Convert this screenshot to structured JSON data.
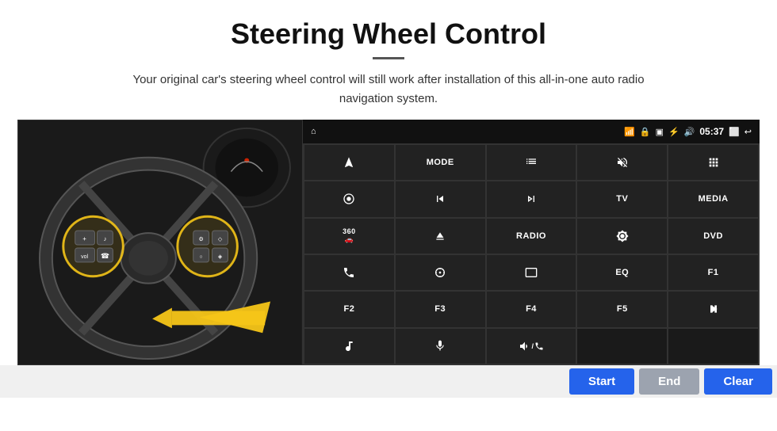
{
  "header": {
    "title": "Steering Wheel Control",
    "subtitle": "Your original car's steering wheel control will still work after installation of this all-in-one auto radio navigation system."
  },
  "statusBar": {
    "time": "05:37",
    "icons": [
      "home",
      "wifi",
      "lock",
      "sim",
      "bluetooth",
      "volume",
      "back"
    ]
  },
  "buttons": [
    {
      "id": "b1",
      "type": "icon",
      "icon": "navigate",
      "label": ""
    },
    {
      "id": "b2",
      "type": "text",
      "label": "MODE"
    },
    {
      "id": "b3",
      "type": "icon",
      "icon": "list",
      "label": ""
    },
    {
      "id": "b4",
      "type": "icon",
      "icon": "mute",
      "label": ""
    },
    {
      "id": "b5",
      "type": "icon",
      "icon": "apps",
      "label": ""
    },
    {
      "id": "b6",
      "type": "icon",
      "icon": "settings-circle",
      "label": ""
    },
    {
      "id": "b7",
      "type": "icon",
      "icon": "prev",
      "label": ""
    },
    {
      "id": "b8",
      "type": "icon",
      "icon": "next",
      "label": ""
    },
    {
      "id": "b9",
      "type": "text",
      "label": "TV"
    },
    {
      "id": "b10",
      "type": "text",
      "label": "MEDIA"
    },
    {
      "id": "b11",
      "type": "icon",
      "icon": "360-cam",
      "label": ""
    },
    {
      "id": "b12",
      "type": "icon",
      "icon": "eject",
      "label": ""
    },
    {
      "id": "b13",
      "type": "text",
      "label": "RADIO"
    },
    {
      "id": "b14",
      "type": "icon",
      "icon": "brightness",
      "label": ""
    },
    {
      "id": "b15",
      "type": "text",
      "label": "DVD"
    },
    {
      "id": "b16",
      "type": "icon",
      "icon": "phone",
      "label": ""
    },
    {
      "id": "b17",
      "type": "icon",
      "icon": "navi",
      "label": ""
    },
    {
      "id": "b18",
      "type": "icon",
      "icon": "aspect",
      "label": ""
    },
    {
      "id": "b19",
      "type": "text",
      "label": "EQ"
    },
    {
      "id": "b20",
      "type": "text",
      "label": "F1"
    },
    {
      "id": "b21",
      "type": "text",
      "label": "F2"
    },
    {
      "id": "b22",
      "type": "text",
      "label": "F3"
    },
    {
      "id": "b23",
      "type": "text",
      "label": "F4"
    },
    {
      "id": "b24",
      "type": "text",
      "label": "F5"
    },
    {
      "id": "b25",
      "type": "icon",
      "icon": "play-pause",
      "label": ""
    },
    {
      "id": "b26",
      "type": "icon",
      "icon": "music",
      "label": ""
    },
    {
      "id": "b27",
      "type": "icon",
      "icon": "mic",
      "label": ""
    },
    {
      "id": "b28",
      "type": "icon",
      "icon": "vol-phone",
      "label": ""
    }
  ],
  "bottomButtons": {
    "start": "Start",
    "end": "End",
    "clear": "Clear"
  },
  "colors": {
    "panelBg": "#111",
    "buttonBg": "#222",
    "accent": "#2563eb",
    "disabled": "#9ca3af"
  }
}
